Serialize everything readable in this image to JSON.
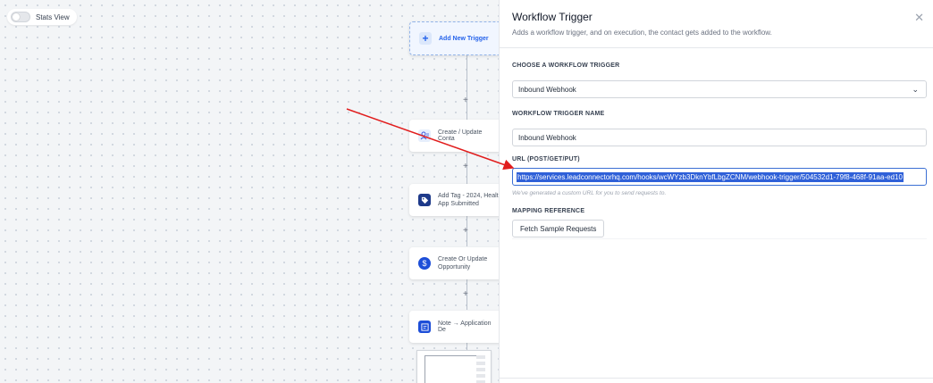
{
  "canvas": {
    "stats_toggle_label": "Stats View",
    "trigger_node": {
      "label": "Add New Trigger",
      "icon": "plus-icon"
    },
    "plus_symbol": "+",
    "nodes": [
      {
        "label": "Create / Update Conta",
        "icon": "contact-icon"
      },
      {
        "label": "Add Tag - 2024, Healt\nApp Submitted",
        "icon": "tag-icon"
      },
      {
        "label": "Create Or Update\nOpportunity",
        "icon": "dollar-icon"
      },
      {
        "label": "Note → Application De",
        "icon": "note-icon"
      }
    ]
  },
  "panel": {
    "title": "Workflow Trigger",
    "subtitle": "Adds a workflow trigger, and on execution, the contact gets added to the workflow.",
    "choose_label": "CHOOSE A WORKFLOW TRIGGER",
    "choose_value": "Inbound Webhook",
    "name_label": "WORKFLOW TRIGGER NAME",
    "name_value": "Inbound Webhook",
    "url_label": "URL (POST/GET/PUT)",
    "url_value": "https://services.leadconnectorhq.com/hooks/wcWYzb3DknYbfLbgZCNM/webhook-trigger/504532d1-79f8-468f-91aa-ed10",
    "url_hint": "We've generated a custom URL for you to send requests to.",
    "mapping_label": "MAPPING REFERENCE",
    "fetch_button": "Fetch Sample Requests"
  },
  "colors": {
    "accent": "#2f60d8",
    "annotation_arrow": "#e11d1d"
  }
}
